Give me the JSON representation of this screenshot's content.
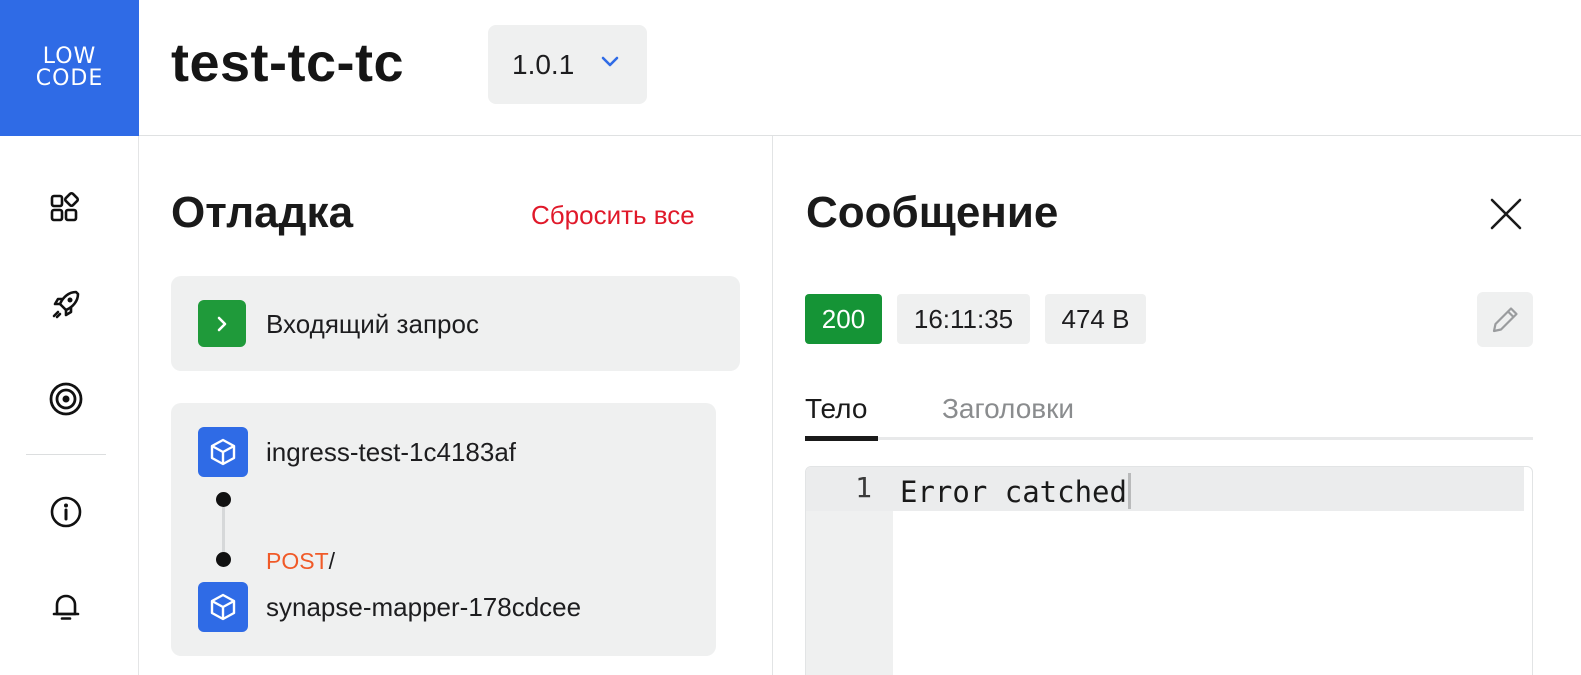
{
  "header": {
    "logo_line1": "LOW",
    "logo_line2": "CODE",
    "app_title": "test-tc-tc",
    "version": "1.0.1"
  },
  "sidebar": {
    "items": [
      {
        "icon": "apps-grid-icon"
      },
      {
        "icon": "rocket-icon"
      },
      {
        "icon": "target-icon"
      },
      {
        "icon": "info-icon"
      },
      {
        "icon": "bell-icon"
      }
    ]
  },
  "debug": {
    "title": "Отладка",
    "reset_label": "Сбросить все",
    "incoming_label": "Входящий запрос",
    "chain": {
      "source": "ingress-test-1c4183af",
      "method": "POST",
      "path": "/",
      "target": "synapse-mapper-178cdcee"
    }
  },
  "message": {
    "title": "Сообщение",
    "status": "200",
    "time": "16:11:35",
    "size": "474 B",
    "tabs": [
      {
        "label": "Тело",
        "active": true
      },
      {
        "label": "Заголовки",
        "active": false
      }
    ],
    "editor": {
      "line_number": "1",
      "content": "Error catched"
    }
  },
  "colors": {
    "brand": "#2f6be6",
    "success": "#159436",
    "danger": "#e0192a",
    "method": "#f05a28"
  }
}
